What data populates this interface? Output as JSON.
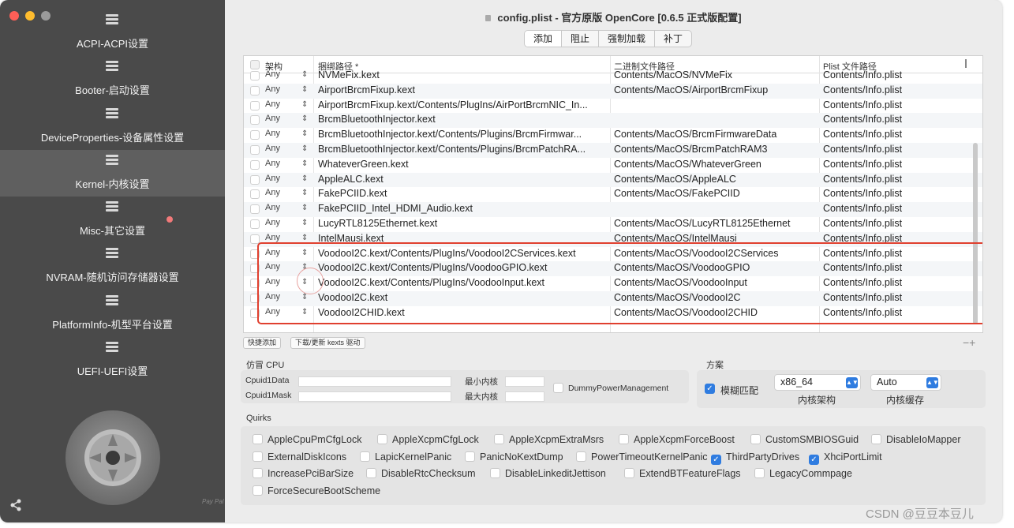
{
  "window": {
    "title": "config.plist - 官方原版 OpenCore [0.6.5 正式版配置]",
    "traffic_colors": [
      "#ff5f57",
      "#febc2e",
      "#9a9a9a"
    ]
  },
  "sidebar": {
    "items": [
      {
        "label": "ACPI-ACPI设置"
      },
      {
        "label": "Booter-启动设置"
      },
      {
        "label": "DeviceProperties-设备属性设置"
      },
      {
        "label": "Kernel-内核设置"
      },
      {
        "label": "Misc-其它设置"
      },
      {
        "label": "NVRAM-随机访问存储器设置"
      },
      {
        "label": "PlatformInfo-机型平台设置"
      },
      {
        "label": "UEFI-UEFI设置"
      }
    ],
    "active_index": 3,
    "footer_text": "Pay Pal"
  },
  "tabs": [
    "添加",
    "阻止",
    "强制加载",
    "补丁"
  ],
  "table": {
    "headers": [
      "架构",
      "捆绑路径 *",
      "二进制文件路径",
      "Plist 文件路径"
    ],
    "rows": [
      {
        "arch": "Any",
        "bundle": "NVMeFix.kext",
        "exec": "Contents/MacOS/NVMeFix",
        "plist": "Contents/Info.plist"
      },
      {
        "arch": "Any",
        "bundle": "AirportBrcmFixup.kext",
        "exec": "Contents/MacOS/AirportBrcmFixup",
        "plist": "Contents/Info.plist"
      },
      {
        "arch": "Any",
        "bundle": "AirportBrcmFixup.kext/Contents/PlugIns/AirPortBrcmNIC_In...",
        "exec": "",
        "plist": "Contents/Info.plist"
      },
      {
        "arch": "Any",
        "bundle": "BrcmBluetoothInjector.kext",
        "exec": "",
        "plist": "Contents/Info.plist"
      },
      {
        "arch": "Any",
        "bundle": "BrcmBluetoothInjector.kext/Contents/Plugins/BrcmFirmwar...",
        "exec": "Contents/MacOS/BrcmFirmwareData",
        "plist": "Contents/Info.plist"
      },
      {
        "arch": "Any",
        "bundle": "BrcmBluetoothInjector.kext/Contents/Plugins/BrcmPatchRA...",
        "exec": "Contents/MacOS/BrcmPatchRAM3",
        "plist": "Contents/Info.plist"
      },
      {
        "arch": "Any",
        "bundle": "WhateverGreen.kext",
        "exec": "Contents/MacOS/WhateverGreen",
        "plist": "Contents/Info.plist"
      },
      {
        "arch": "Any",
        "bundle": "AppleALC.kext",
        "exec": "Contents/MacOS/AppleALC",
        "plist": "Contents/Info.plist"
      },
      {
        "arch": "Any",
        "bundle": "FakePCIID.kext",
        "exec": "Contents/MacOS/FakePCIID",
        "plist": "Contents/Info.plist"
      },
      {
        "arch": "Any",
        "bundle": "FakePCIID_Intel_HDMI_Audio.kext",
        "exec": "",
        "plist": "Contents/Info.plist"
      },
      {
        "arch": "Any",
        "bundle": "LucyRTL8125Ethernet.kext",
        "exec": "Contents/MacOS/LucyRTL8125Ethernet",
        "plist": "Contents/Info.plist"
      },
      {
        "arch": "Any",
        "bundle": "IntelMausi.kext",
        "exec": "Contents/MacOS/IntelMausi",
        "plist": "Contents/Info.plist"
      },
      {
        "arch": "Any",
        "bundle": "VoodooI2C.kext/Contents/PlugIns/VoodooI2CServices.kext",
        "exec": "Contents/MacOS/VoodooI2CServices",
        "plist": "Contents/Info.plist"
      },
      {
        "arch": "Any",
        "bundle": "VoodooI2C.kext/Contents/PlugIns/VoodooGPIO.kext",
        "exec": "Contents/MacOS/VoodooGPIO",
        "plist": "Contents/Info.plist"
      },
      {
        "arch": "Any",
        "bundle": "VoodooI2C.kext/Contents/PlugIns/VoodooInput.kext",
        "exec": "Contents/MacOS/VoodooInput",
        "plist": "Contents/Info.plist"
      },
      {
        "arch": "Any",
        "bundle": "VoodooI2C.kext",
        "exec": "Contents/MacOS/VoodooI2C",
        "plist": "Contents/Info.plist"
      },
      {
        "arch": "Any",
        "bundle": "VoodooI2CHID.kext",
        "exec": "Contents/MacOS/VoodooI2CHID",
        "plist": "Contents/Info.plist"
      }
    ],
    "highlight_color": "#e0402f"
  },
  "actions": {
    "quick_add": "快捷添加",
    "download": "下载/更新 kexts 驱动",
    "plus_minus": "−+"
  },
  "cpu": {
    "section": "仿冒 CPU",
    "cpuid1data": "Cpuid1Data",
    "cpuid1mask": "Cpuid1Mask",
    "min_kernel": "最小内核",
    "max_kernel": "最大内核",
    "dummy_pm": "DummyPowerManagement"
  },
  "scheme": {
    "section": "方案",
    "fuzzy_match": "模糊匹配",
    "arch_value": "x86_64",
    "arch_label": "内核架构",
    "cache_value": "Auto",
    "cache_label": "内核缓存"
  },
  "quirks": {
    "section": "Quirks",
    "rows": [
      [
        {
          "name": "AppleCpuPmCfgLock",
          "on": false
        },
        {
          "name": "AppleXcpmCfgLock",
          "on": false
        },
        {
          "name": "AppleXcpmExtraMsrs",
          "on": false
        },
        {
          "name": "AppleXcpmForceBoost",
          "on": false
        },
        {
          "name": "CustomSMBIOSGuid",
          "on": false
        },
        {
          "name": "DisableIoMapper",
          "on": false
        }
      ],
      [
        {
          "name": "ExternalDiskIcons",
          "on": false
        },
        {
          "name": "LapicKernelPanic",
          "on": false
        },
        {
          "name": "PanicNoKextDump",
          "on": false
        },
        {
          "name": "PowerTimeoutKernelPanic",
          "on": false
        },
        {
          "name": "ThirdPartyDrives",
          "on": true
        },
        {
          "name": "XhciPortLimit",
          "on": true
        }
      ],
      [
        {
          "name": "IncreasePciBarSize",
          "on": false
        },
        {
          "name": "DisableRtcChecksum",
          "on": false
        },
        {
          "name": "DisableLinkeditJettison",
          "on": false
        },
        {
          "name": "ExtendBTFeatureFlags",
          "on": false
        },
        {
          "name": "LegacyCommpage",
          "on": false
        }
      ],
      [
        {
          "name": "ForceSecureBootScheme",
          "on": false
        }
      ]
    ]
  },
  "watermark": "CSDN @豆豆本豆儿"
}
